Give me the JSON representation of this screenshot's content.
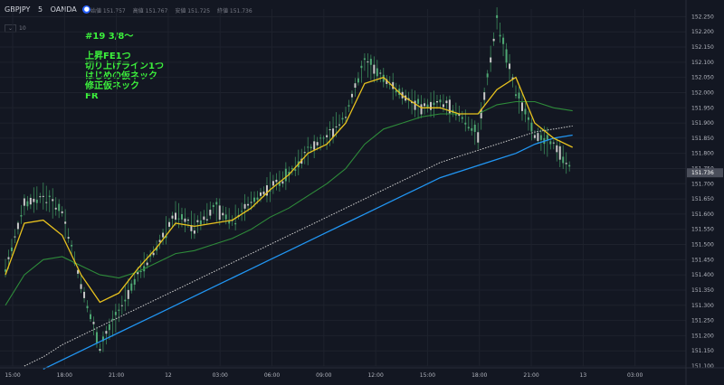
{
  "header": {
    "symbol": "GBPJPY",
    "interval": "5",
    "exchange": "OANDA",
    "ohlc": [
      "始値 151.757",
      "高値 151.767",
      "安値 151.725",
      "終値 151.736"
    ],
    "sub_box": "10"
  },
  "notes": {
    "line1": "#19 3/8～",
    "line2": "上昇FE1つ",
    "line3": "切り上げライン1つ",
    "line4": "はじめの仮ネック",
    "line5": "修正仮ネック",
    "line6": "FR"
  },
  "colors": {
    "background": "#131722",
    "candle": "#3a8a5a",
    "ma_fast": "#e8c21e",
    "ma_mid": "#2e8b3a",
    "ma_slow": "#d0d0d0",
    "ma_blue": "#2196f3",
    "last_price_bg": "#4a4e5a"
  },
  "chart_data": {
    "type": "line",
    "title": "",
    "last_price": "151.736",
    "y_ticks": [
      "152.250",
      "152.200",
      "152.150",
      "152.100",
      "152.050",
      "152.000",
      "151.950",
      "151.900",
      "151.850",
      "151.800",
      "151.750",
      "151.700",
      "151.650",
      "151.600",
      "151.550",
      "151.500",
      "151.450",
      "151.400",
      "151.350",
      "151.300",
      "151.250",
      "151.200",
      "151.150",
      "151.100"
    ],
    "ylim": [
      151.1,
      152.275
    ],
    "x_ticks": [
      "15:00",
      "18:00",
      "21:00",
      "12",
      "03:00",
      "06:00",
      "09:00",
      "12:00",
      "15:00",
      "18:00",
      "21:00",
      "13",
      "03:00"
    ],
    "xlim": [
      0,
      36
    ],
    "x": [
      0,
      1,
      2,
      3,
      4,
      5,
      6,
      7,
      8,
      9,
      10,
      11,
      12,
      13,
      14,
      15,
      16,
      17,
      18,
      19,
      20,
      21,
      22,
      23,
      24,
      25,
      26,
      27,
      28,
      29,
      30
    ],
    "series": [
      {
        "key": "price",
        "values": [
          151.42,
          151.63,
          151.66,
          151.61,
          151.37,
          151.16,
          151.28,
          151.4,
          151.49,
          151.6,
          151.56,
          151.62,
          151.58,
          151.64,
          151.69,
          151.73,
          151.81,
          151.85,
          151.93,
          152.1,
          152.05,
          151.99,
          151.95,
          151.97,
          151.93,
          151.86,
          152.24,
          152.0,
          151.86,
          151.83,
          151.74
        ]
      },
      {
        "key": "ma_fast",
        "values": [
          151.4,
          151.57,
          151.58,
          151.53,
          151.4,
          151.31,
          151.34,
          151.42,
          151.49,
          151.57,
          151.56,
          151.57,
          151.58,
          151.62,
          151.68,
          151.73,
          151.8,
          151.83,
          151.9,
          152.03,
          152.05,
          151.99,
          151.95,
          151.95,
          151.93,
          151.93,
          152.01,
          152.05,
          151.9,
          151.85,
          151.82
        ]
      },
      {
        "key": "ma_mid",
        "values": [
          151.3,
          151.4,
          151.45,
          151.46,
          151.43,
          151.4,
          151.39,
          151.41,
          151.44,
          151.47,
          151.48,
          151.5,
          151.52,
          151.55,
          151.59,
          151.62,
          151.66,
          151.7,
          151.75,
          151.83,
          151.88,
          151.9,
          151.92,
          151.93,
          151.93,
          151.93,
          151.96,
          151.97,
          151.97,
          151.95,
          151.94
        ]
      },
      {
        "key": "ma_slow",
        "values": [
          null,
          151.1,
          151.13,
          151.17,
          151.2,
          151.23,
          151.26,
          151.29,
          151.32,
          151.35,
          151.38,
          151.41,
          151.44,
          151.47,
          151.5,
          151.53,
          151.56,
          151.59,
          151.62,
          151.65,
          151.68,
          151.71,
          151.74,
          151.77,
          151.79,
          151.81,
          151.83,
          151.85,
          151.87,
          151.88,
          151.89
        ]
      },
      {
        "key": "ma_blue",
        "values": [
          null,
          null,
          151.09,
          151.12,
          151.15,
          151.18,
          151.21,
          151.24,
          151.27,
          151.3,
          151.33,
          151.36,
          151.39,
          151.42,
          151.45,
          151.48,
          151.51,
          151.54,
          151.57,
          151.6,
          151.63,
          151.66,
          151.69,
          151.72,
          151.74,
          151.76,
          151.78,
          151.8,
          151.83,
          151.85,
          151.86
        ]
      }
    ]
  }
}
